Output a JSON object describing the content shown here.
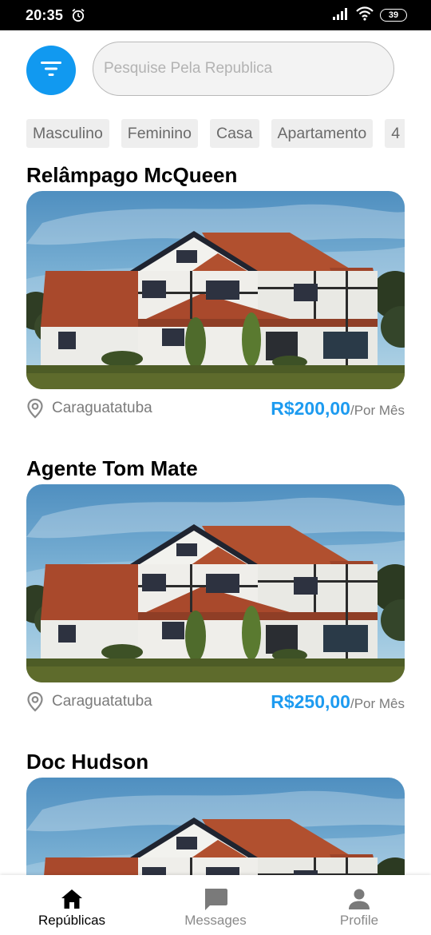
{
  "status_bar": {
    "time": "20:35",
    "battery": "39"
  },
  "header": {
    "search_placeholder": "Pesquise Pela Republica",
    "filter_icon": "filter-icon"
  },
  "filters": [
    "Masculino",
    "Feminino",
    "Casa",
    "Apartamento",
    "4"
  ],
  "listings": [
    {
      "title": "Relâmpago McQueen",
      "location": "Caraguatatuba",
      "price": "R$200,00",
      "period": "/Por Mês"
    },
    {
      "title": "Agente Tom Mate",
      "location": "Caraguatatuba",
      "price": "R$250,00",
      "period": "/Por Mês"
    },
    {
      "title": "Doc Hudson"
    }
  ],
  "bottom_nav": [
    {
      "label": "Repúblicas",
      "icon": "home-icon",
      "active": true
    },
    {
      "label": "Messages",
      "icon": "message-icon",
      "active": false
    },
    {
      "label": "Profile",
      "icon": "profile-icon",
      "active": false
    }
  ],
  "colors": {
    "accent": "#1199f0",
    "price": "#1d9bf0",
    "muted": "#7b7b7b"
  }
}
